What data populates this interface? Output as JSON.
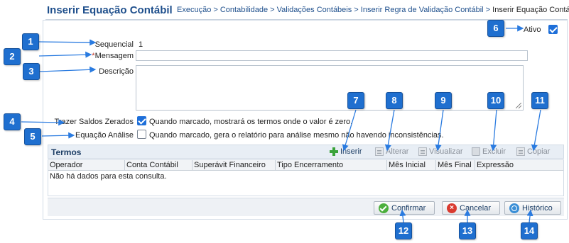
{
  "header": {
    "title": "Inserir Equação Contábil",
    "breadcrumb": "Execução > Contabilidade > Validações Contábeis > Inserir Regra de Validação Contábil >",
    "breadcrumb_current": "Inserir Equação Contábil"
  },
  "form": {
    "ativo_label": "Ativo",
    "ativo_checked": true,
    "sequencial_label": "Sequencial",
    "sequencial_value": "1",
    "mensagem_required": "*",
    "mensagem_label": "Mensagem",
    "mensagem_value": "",
    "descricao_label": "Descrição",
    "descricao_value": "",
    "saldos_label": "Trazer Saldos Zerados",
    "saldos_checked": true,
    "saldos_text": "Quando marcado, mostrará os termos onde o valor é zero.",
    "analise_label": "Equação Análise",
    "analise_checked": false,
    "analise_text": "Quando marcado, gera o relatório para análise mesmo não havendo inconsistências."
  },
  "termos": {
    "title": "Termos",
    "toolbar": {
      "inserir": "Inserir",
      "alterar": "Alterar",
      "visualizar": "Visualizar",
      "excluir": "Excluir",
      "copiar": "Copiar"
    },
    "columns": [
      "Operador",
      "Conta Contábil",
      "Superávit Financeiro",
      "Tipo Encerramento",
      "Mês Inicial",
      "Mês Final",
      "Expressão"
    ],
    "empty_message": "Não há dados para esta consulta."
  },
  "footer": {
    "confirmar": "Confirmar",
    "cancelar": "Cancelar",
    "historico": "Histórico"
  },
  "callouts": [
    "1",
    "2",
    "3",
    "4",
    "5",
    "6",
    "7",
    "8",
    "9",
    "10",
    "11",
    "12",
    "13",
    "14"
  ],
  "colors": {
    "title": "#1e4f8c",
    "callout": "#1f6fcf",
    "checkbox_on": "#1e6fd9",
    "confirm_icon": "#4caf3d",
    "cancel_icon": "#d93a2f"
  },
  "icons": {
    "inserir": "plus-icon",
    "alterar": "edit-doc-icon",
    "visualizar": "view-doc-icon",
    "excluir": "trash-icon",
    "copiar": "copy-doc-icon",
    "confirmar": "check-circle-icon",
    "cancelar": "x-circle-icon",
    "historico": "history-icon"
  }
}
